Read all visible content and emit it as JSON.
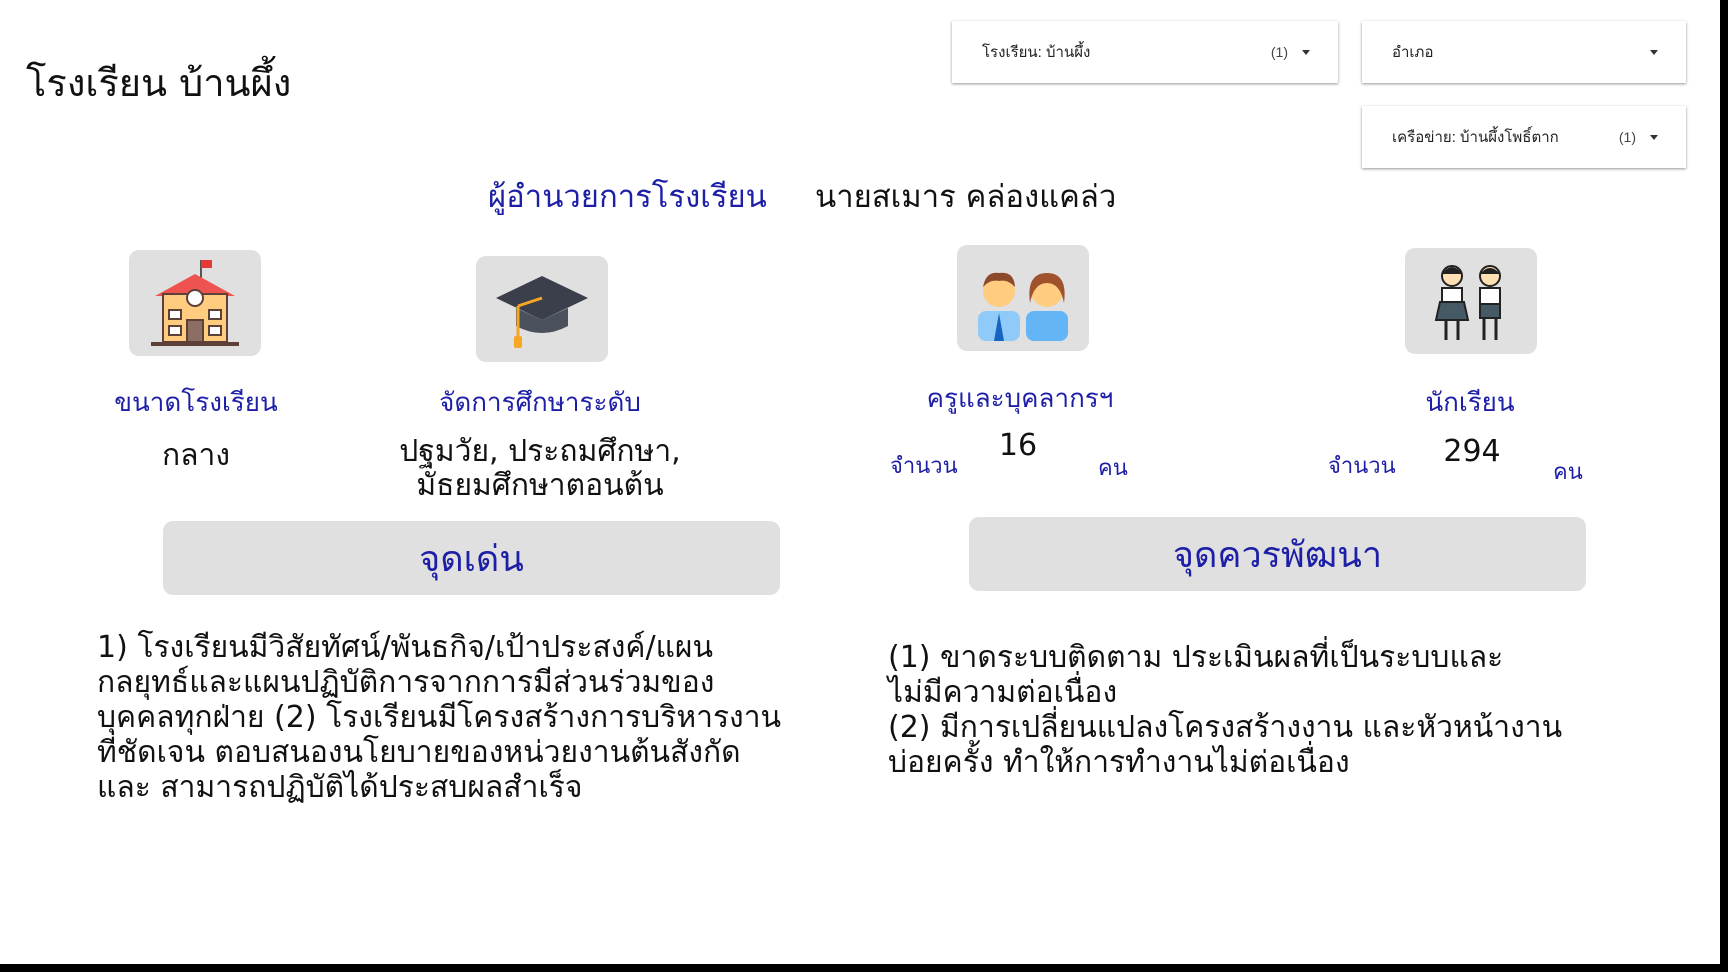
{
  "header": {
    "school_title": "โรงเรียน บ้านผึ้ง"
  },
  "filters": {
    "school": {
      "label": "โรงเรียน",
      "value": ": บ้านผึ้ง",
      "count": "(1)"
    },
    "district": {
      "label": "อำเภอ"
    },
    "network": {
      "label": "เครือข่าย",
      "value": ": บ้านผึ้งโพธิ์ตาก",
      "count": "(1)"
    }
  },
  "director": {
    "label": "ผู้อำนวยการโรงเรียน",
    "name": "นายสเมาร คล่องแคล่ว"
  },
  "cards": {
    "size": {
      "label": "ขนาดโรงเรียน",
      "value": "กลาง",
      "icon": "school-building-icon"
    },
    "level": {
      "label": "จัดการศึกษาระดับ",
      "value_line1": "ปฐมวัย, ประถมศึกษา,",
      "value_line2": "มัธยมศึกษาตอนต้น",
      "icon": "graduation-cap-icon"
    },
    "teachers": {
      "label": "ครูและบุคลากรฯ",
      "prefix": "จำนวน",
      "count": "16",
      "unit": "คน",
      "icon": "teachers-icon"
    },
    "students": {
      "label": "นักเรียน",
      "prefix": "จำนวน",
      "count": "294",
      "unit": "คน",
      "icon": "students-icon"
    }
  },
  "strengths": {
    "title": "จุดเด่น",
    "lines": [
      "1) โรงเรียนมีวิสัยทัศน์/พันธกิจ/เป้าประสงค์/แผน",
      "กลยุทธ์และแผนปฏิบัติการจากการมีส่วนร่วมของ",
      "บุคคลทุกฝ่าย (2) โรงเรียนมีโครงสร้างการบริหารงาน",
      "ที่ชัดเจน ตอบสนองนโยบายของหน่วยงานต้นสังกัด",
      "และ สามารถปฏิบัติได้ประสบผลสำเร็จ"
    ]
  },
  "improvements": {
    "title": "จุดควรพัฒนา",
    "lines": [
      "(1) ขาดระบบติดตาม ประเมินผลที่เป็นระบบและ",
      "ไม่มีความต่อเนื่อง",
      "(2) มีการเปลี่ยนแปลงโครงสร้างงาน และหัวหน้างาน",
      "บ่อยครั้ง ทำให้การทำงานไม่ต่อเนื่อง"
    ]
  },
  "colors": {
    "accent": "#1d1fa6",
    "panel": "#e0e0e0"
  }
}
